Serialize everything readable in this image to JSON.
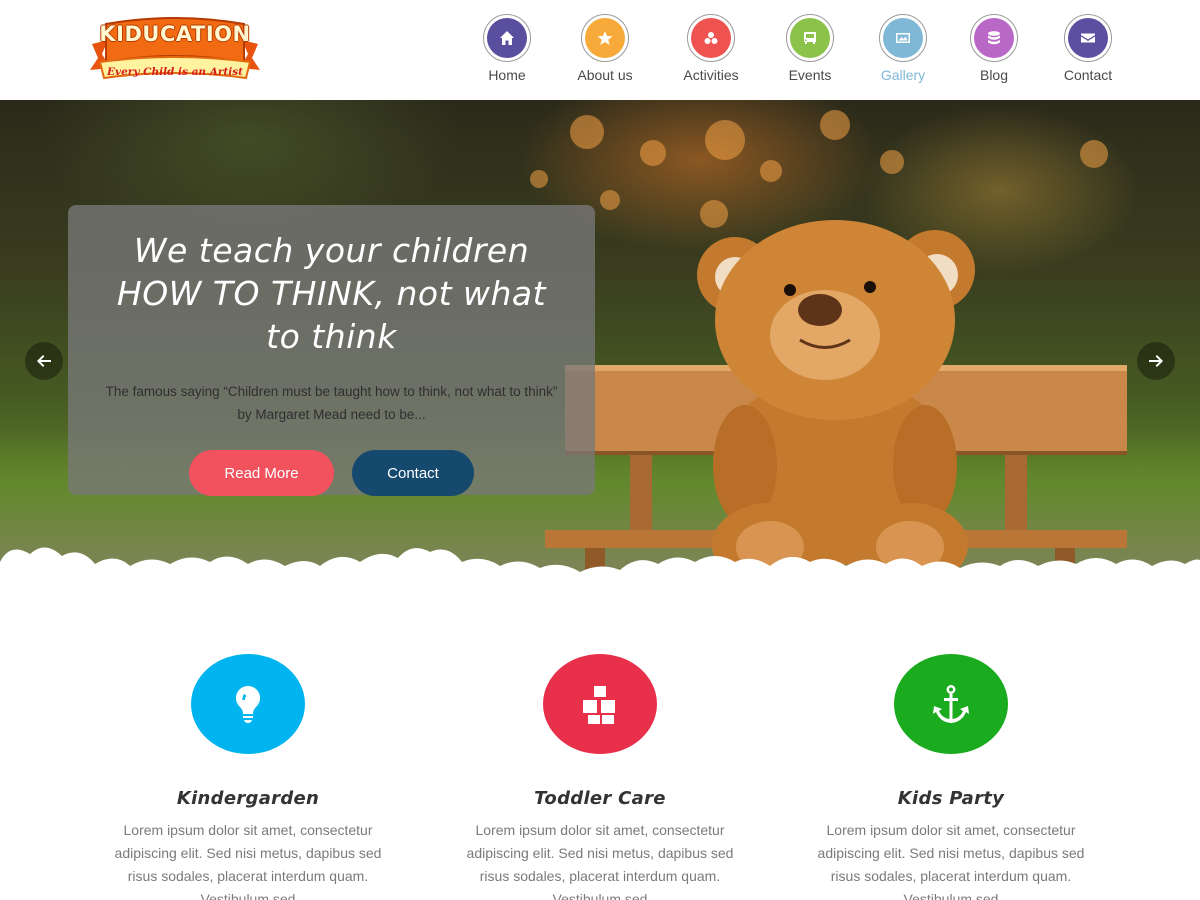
{
  "brand": {
    "title": "KIDUCATION",
    "tagline": "Every Child is an Artist"
  },
  "nav": {
    "items": [
      {
        "label": "Home",
        "icon": "home-icon",
        "color": "#5a4f9e"
      },
      {
        "label": "About us",
        "icon": "star-icon",
        "color": "#f7a93a"
      },
      {
        "label": "Activities",
        "icon": "cubes-icon",
        "color": "#ef5350"
      },
      {
        "label": "Events",
        "icon": "bus-icon",
        "color": "#8bc34a"
      },
      {
        "label": "Gallery",
        "icon": "image-icon",
        "color": "#7fb8d6",
        "active": true
      },
      {
        "label": "Blog",
        "icon": "database-icon",
        "color": "#ba68c8"
      },
      {
        "label": "Contact",
        "icon": "envelope-icon",
        "color": "#5c4f9f"
      }
    ]
  },
  "hero": {
    "title": "We teach your children HOW TO THINK, not what to think",
    "text": "The famous saying “Children must be taught how to think, not what to think” by Margaret Mead need to be...",
    "read_more": "Read More",
    "contact": "Contact",
    "colors": {
      "read_more": "#f2515e",
      "contact": "#154a6e"
    }
  },
  "features": [
    {
      "title": "Kindergarden",
      "icon": "lightbulb-icon",
      "color": "#00b4ef",
      "text": "Lorem ipsum dolor sit amet, consectetur adipiscing elit. Sed nisi metus, dapibus sed risus sodales, placerat interdum quam. Vestibulum sed"
    },
    {
      "title": "Toddler Care",
      "icon": "cubes-icon",
      "color": "#e8304a",
      "text": "Lorem ipsum dolor sit amet, consectetur adipiscing elit. Sed nisi metus, dapibus sed risus sodales, placerat interdum quam. Vestibulum sed"
    },
    {
      "title": "Kids Party",
      "icon": "anchor-icon",
      "color": "#1aab1f",
      "text": "Lorem ipsum dolor sit amet, consectetur adipiscing elit. Sed nisi metus, dapibus sed risus sodales, placerat interdum quam. Vestibulum sed"
    }
  ]
}
